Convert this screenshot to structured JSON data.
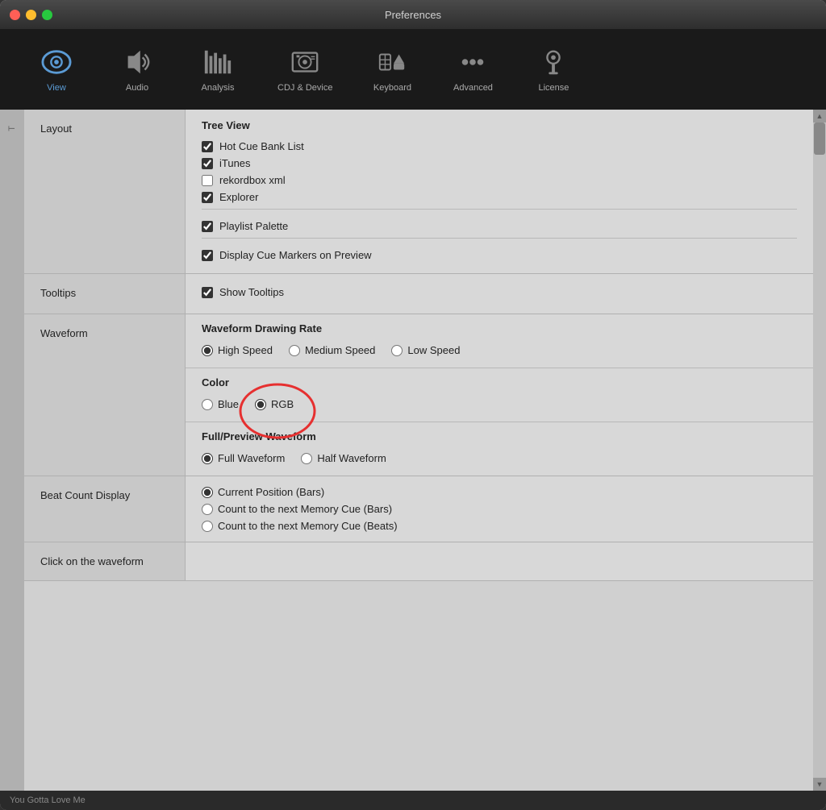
{
  "window": {
    "title": "Preferences"
  },
  "toolbar": {
    "items": [
      {
        "id": "view",
        "label": "View",
        "active": true
      },
      {
        "id": "audio",
        "label": "Audio",
        "active": false
      },
      {
        "id": "analysis",
        "label": "Analysis",
        "active": false
      },
      {
        "id": "cdj",
        "label": "CDJ & Device",
        "active": false
      },
      {
        "id": "keyboard",
        "label": "Keyboard",
        "active": false
      },
      {
        "id": "advanced",
        "label": "Advanced",
        "active": false
      },
      {
        "id": "license",
        "label": "License",
        "active": false
      }
    ]
  },
  "sections": {
    "layout": {
      "label": "Layout",
      "tree_view_title": "Tree View",
      "checkboxes": [
        {
          "id": "hot_cue",
          "label": "Hot Cue Bank List",
          "checked": true
        },
        {
          "id": "itunes",
          "label": "iTunes",
          "checked": true
        },
        {
          "id": "rekordbox",
          "label": "rekordbox xml",
          "checked": false
        },
        {
          "id": "explorer",
          "label": "Explorer",
          "checked": true
        }
      ],
      "playlist_palette": {
        "label": "Playlist Palette",
        "checked": true
      },
      "cue_markers": {
        "label": "Display Cue Markers on Preview",
        "checked": true
      }
    },
    "tooltips": {
      "label": "Tooltips",
      "show_tooltips": {
        "label": "Show Tooltips",
        "checked": true
      }
    },
    "waveform": {
      "label": "Waveform",
      "drawing_rate_title": "Waveform Drawing Rate",
      "speed_options": [
        {
          "id": "high_speed",
          "label": "High Speed",
          "selected": true
        },
        {
          "id": "medium_speed",
          "label": "Medium Speed",
          "selected": false
        },
        {
          "id": "low_speed",
          "label": "Low Speed",
          "selected": false
        }
      ],
      "color_title": "Color",
      "color_options": [
        {
          "id": "blue",
          "label": "Blue",
          "selected": false
        },
        {
          "id": "rgb",
          "label": "RGB",
          "selected": true
        }
      ],
      "waveform_title": "Full/Preview Waveform",
      "waveform_options": [
        {
          "id": "full_waveform",
          "label": "Full Waveform",
          "selected": true
        },
        {
          "id": "half_waveform",
          "label": "Half Waveform",
          "selected": false
        }
      ]
    },
    "beat_count": {
      "label": "Beat Count Display",
      "options": [
        {
          "id": "current_pos",
          "label": "Current Position (Bars)",
          "selected": true
        },
        {
          "id": "next_memory_bars",
          "label": "Count to the next Memory Cue (Bars)",
          "selected": false
        },
        {
          "id": "next_memory_beats",
          "label": "Count to the next Memory Cue (Beats)",
          "selected": false
        }
      ]
    },
    "click_waveform": {
      "label": "Click on the waveform"
    }
  },
  "bottom": {
    "track_name": "You Gotta Love Me"
  }
}
